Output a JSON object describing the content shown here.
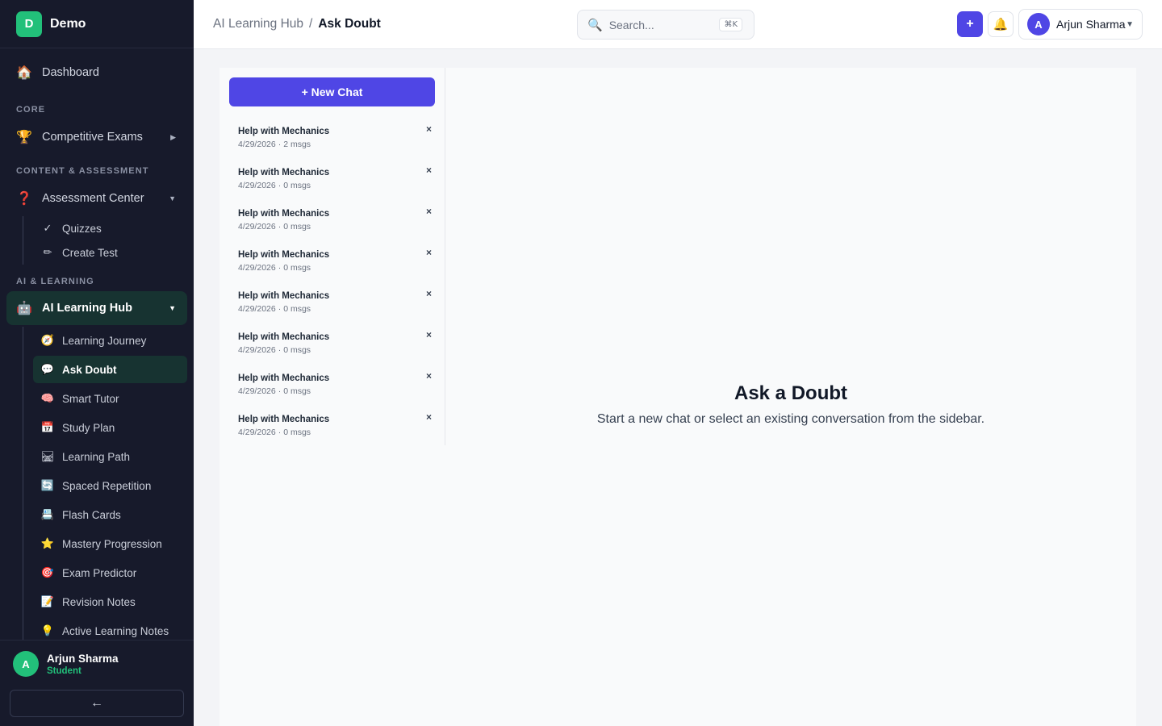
{
  "brand": {
    "logo_letter": "D",
    "name": "Demo"
  },
  "sidebar": {
    "dashboard": {
      "icon": "🏠",
      "label": "Dashboard"
    },
    "sections": {
      "core": "CORE",
      "content": "CONTENT & ASSESSMENT",
      "ai": "AI & LEARNING"
    },
    "competitive_exams": {
      "icon": "🏆",
      "label": "Competitive Exams"
    },
    "assessment_center": {
      "icon": "❓",
      "label": "Assessment Center"
    },
    "assessment_sub": [
      {
        "icon": "✓",
        "label": "Quizzes"
      },
      {
        "icon": "✏",
        "label": "Create Test"
      }
    ],
    "ai_hub": {
      "icon": "🤖",
      "label": "AI Learning Hub"
    },
    "ai_sub": [
      {
        "icon": "🧭",
        "label": "Learning Journey"
      },
      {
        "icon": "💬",
        "label": "Ask Doubt"
      },
      {
        "icon": "🧠",
        "label": "Smart Tutor"
      },
      {
        "icon": "📅",
        "label": "Study Plan"
      },
      {
        "icon": "🛤",
        "label": "Learning Path"
      },
      {
        "icon": "🔄",
        "label": "Spaced Repetition"
      },
      {
        "icon": "📇",
        "label": "Flash Cards"
      },
      {
        "icon": "⭐",
        "label": "Mastery Progression"
      },
      {
        "icon": "🎯",
        "label": "Exam Predictor"
      },
      {
        "icon": "📝",
        "label": "Revision Notes"
      },
      {
        "icon": "💡",
        "label": "Active Learning Notes"
      }
    ],
    "footer": {
      "avatar_letter": "A",
      "name": "Arjun Sharma",
      "role": "Student",
      "collapse_icon": "←"
    }
  },
  "header": {
    "breadcrumb": {
      "parent": "AI Learning Hub",
      "separator": "/",
      "current": "Ask Doubt"
    },
    "search": {
      "placeholder": "Search...",
      "shortcut": "⌘K"
    },
    "add_icon": "+",
    "bell_icon": "🔔",
    "profile": {
      "avatar_letter": "A",
      "name": "Arjun Sharma",
      "chevron": "▼"
    }
  },
  "chats": {
    "new_chat_label": "+ New Chat",
    "close_icon": "×",
    "items": [
      {
        "title": "Help with Mechanics",
        "date": "4/29/2026",
        "count": "2 msgs"
      },
      {
        "title": "Help with Mechanics",
        "date": "4/29/2026",
        "count": "0 msgs"
      },
      {
        "title": "Help with Mechanics",
        "date": "4/29/2026",
        "count": "0 msgs"
      },
      {
        "title": "Help with Mechanics",
        "date": "4/29/2026",
        "count": "0 msgs"
      },
      {
        "title": "Help with Mechanics",
        "date": "4/29/2026",
        "count": "0 msgs"
      },
      {
        "title": "Help with Mechanics",
        "date": "4/29/2026",
        "count": "0 msgs"
      },
      {
        "title": "Help with Mechanics",
        "date": "4/29/2026",
        "count": "0 msgs"
      },
      {
        "title": "Help with Mechanics",
        "date": "4/29/2026",
        "count": "0 msgs"
      }
    ]
  },
  "empty_state": {
    "title": "Ask a Doubt",
    "subtitle": "Start a new chat or select an existing conversation from the sidebar."
  },
  "colors": {
    "accent": "#4f46e5",
    "brand_green": "#22c07a",
    "sidebar_bg": "#171a2b",
    "active_bg": "#173331"
  }
}
